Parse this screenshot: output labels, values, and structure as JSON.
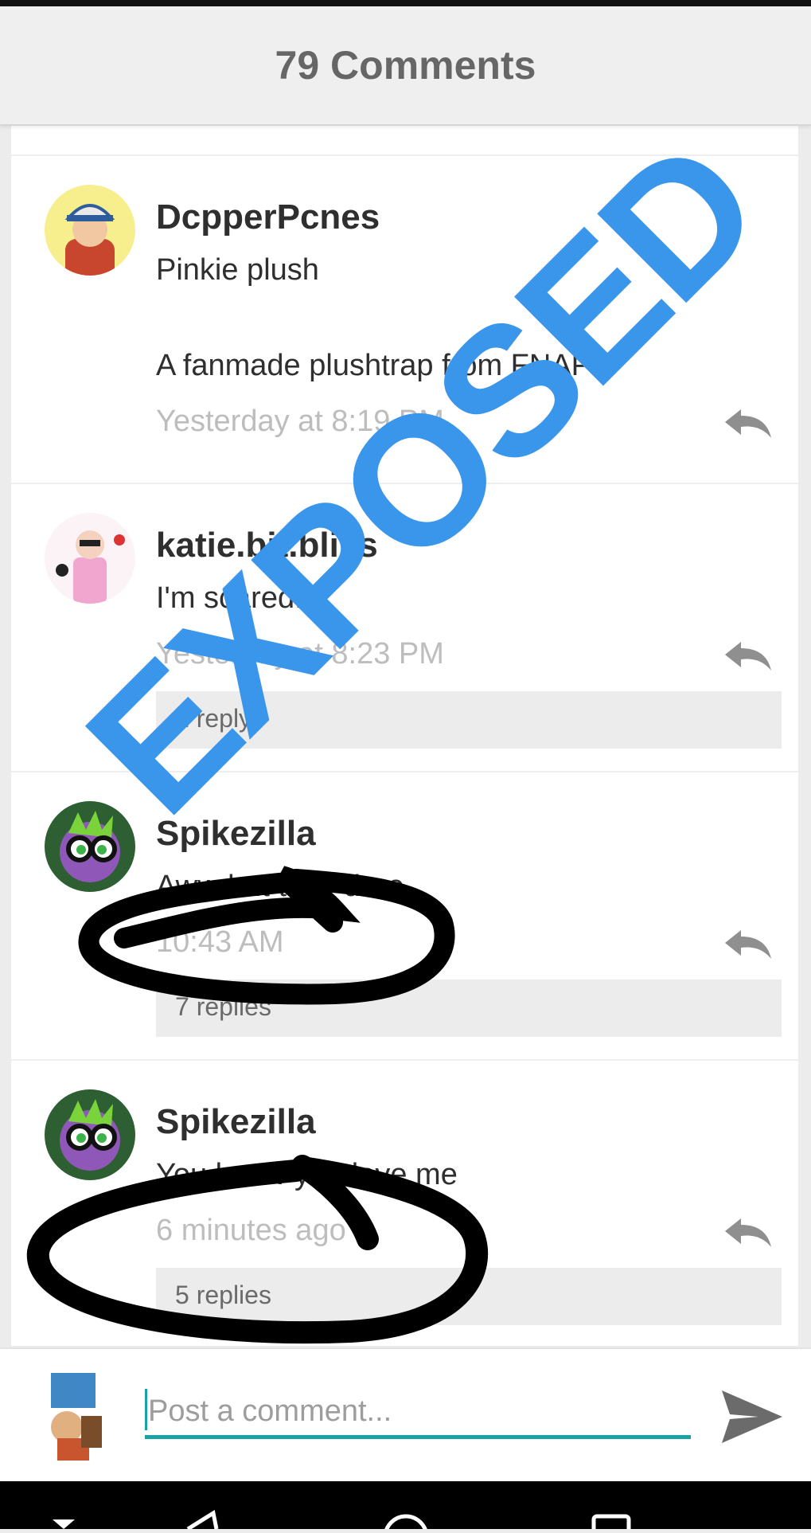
{
  "header": {
    "title": "79 Comments"
  },
  "comments": [
    {
      "username": "DcpperPcnes",
      "line1": "Pinkie plush",
      "line2": "A fanmade plushtrap from FNAP?",
      "time": "Yesterday at 8:19 PM"
    },
    {
      "username": "katie.bit.bliss",
      "line1": "I'm scared...",
      "time": "Yesterday at 8:23 PM",
      "replies": "1 reply"
    },
    {
      "username": "Spikezilla",
      "line1": "Aww but they dare...",
      "time": "10:43 AM",
      "replies": "7 replies"
    },
    {
      "username": "Spikezilla",
      "line1": "You know you love me",
      "time": "6 minutes ago",
      "replies": "5 replies"
    }
  ],
  "composer": {
    "placeholder": "Post a comment..."
  },
  "overlay": {
    "stamp_text": "EXPOSED",
    "stamp_color": "#3a96eb",
    "scribble_color": "#000000"
  },
  "icons": {
    "reply": "reply-arrow-icon",
    "send": "send-icon"
  }
}
